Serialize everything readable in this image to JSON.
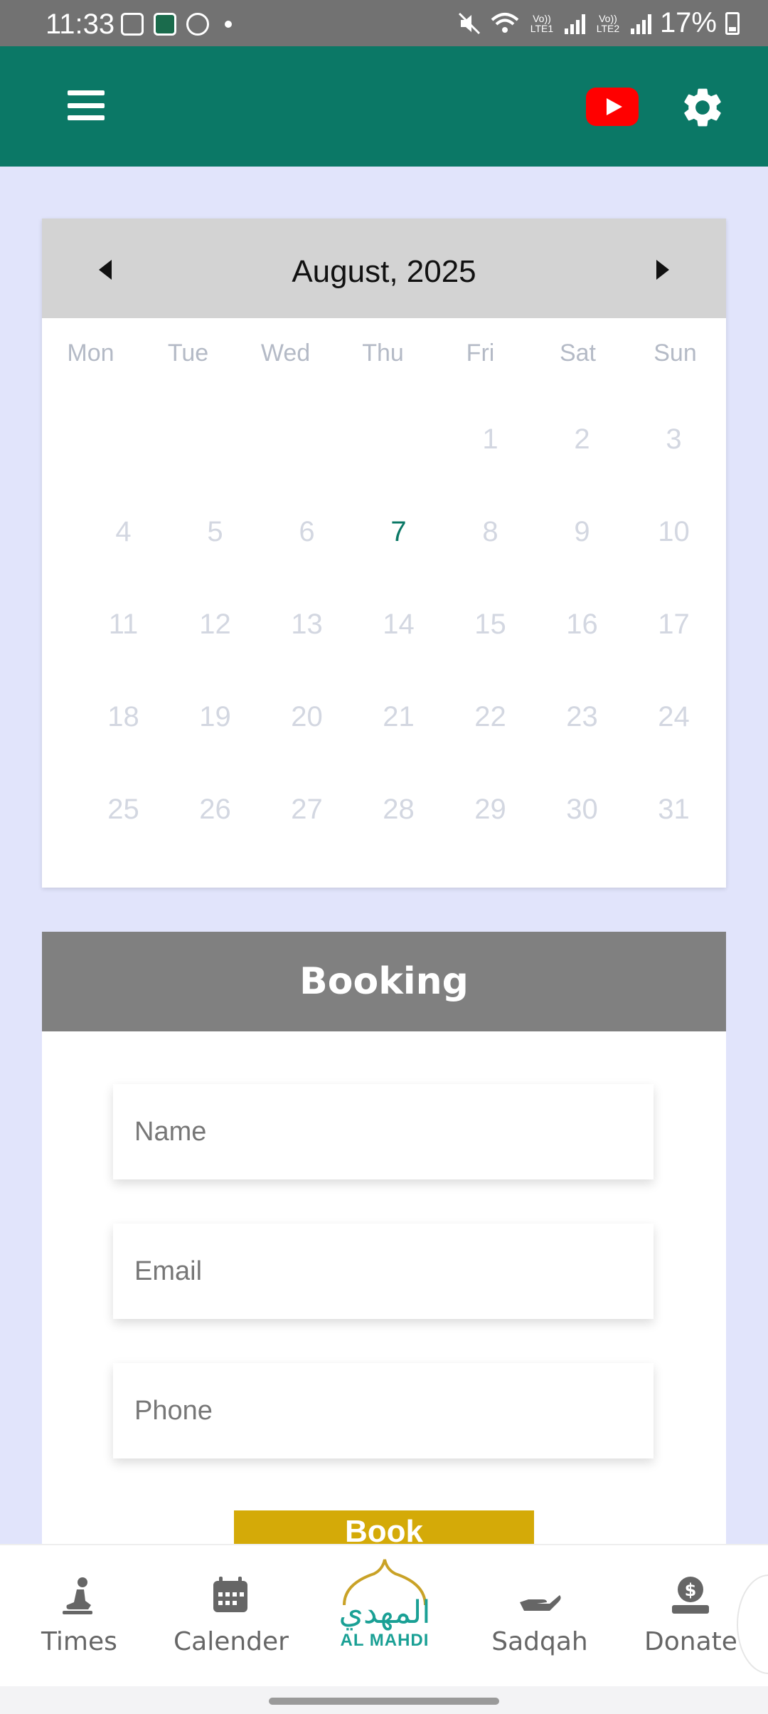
{
  "status_bar": {
    "time": "11:33",
    "battery": "17%",
    "sim1": "Vo)) LTE1",
    "sim2": "Vo)) LTE2"
  },
  "app_bar": {
    "menu_icon": "hamburger-icon",
    "youtube_icon": "youtube-icon",
    "settings_icon": "gear-icon",
    "bg_color": "#0b7866"
  },
  "calendar": {
    "month_label": "August, 2025",
    "weekdays": [
      "Mon",
      "Tue",
      "Wed",
      "Thu",
      "Fri",
      "Sat",
      "Sun"
    ],
    "leading_blanks": 4,
    "days": [
      "1",
      "2",
      "3",
      "4",
      "5",
      "6",
      "7",
      "8",
      "9",
      "10",
      "11",
      "12",
      "13",
      "14",
      "15",
      "16",
      "17",
      "18",
      "19",
      "20",
      "21",
      "22",
      "23",
      "24",
      "25",
      "26",
      "27",
      "28",
      "29",
      "30",
      "31"
    ],
    "today": "7"
  },
  "booking": {
    "title": "Booking",
    "name_placeholder": "Name",
    "email_placeholder": "Email",
    "phone_placeholder": "Phone",
    "book_label": "Book",
    "button_color": "#d4aa08"
  },
  "bottom_nav": {
    "items": [
      {
        "label": "Times",
        "icon": "prayer-icon"
      },
      {
        "label": "Calender",
        "icon": "calendar-icon"
      },
      {
        "label": "Sadqah",
        "icon": "giving-hand-icon"
      },
      {
        "label": "Donate",
        "icon": "donate-icon"
      }
    ],
    "logo_arabic": "المهدي",
    "logo_text": "AL MAHDI"
  }
}
